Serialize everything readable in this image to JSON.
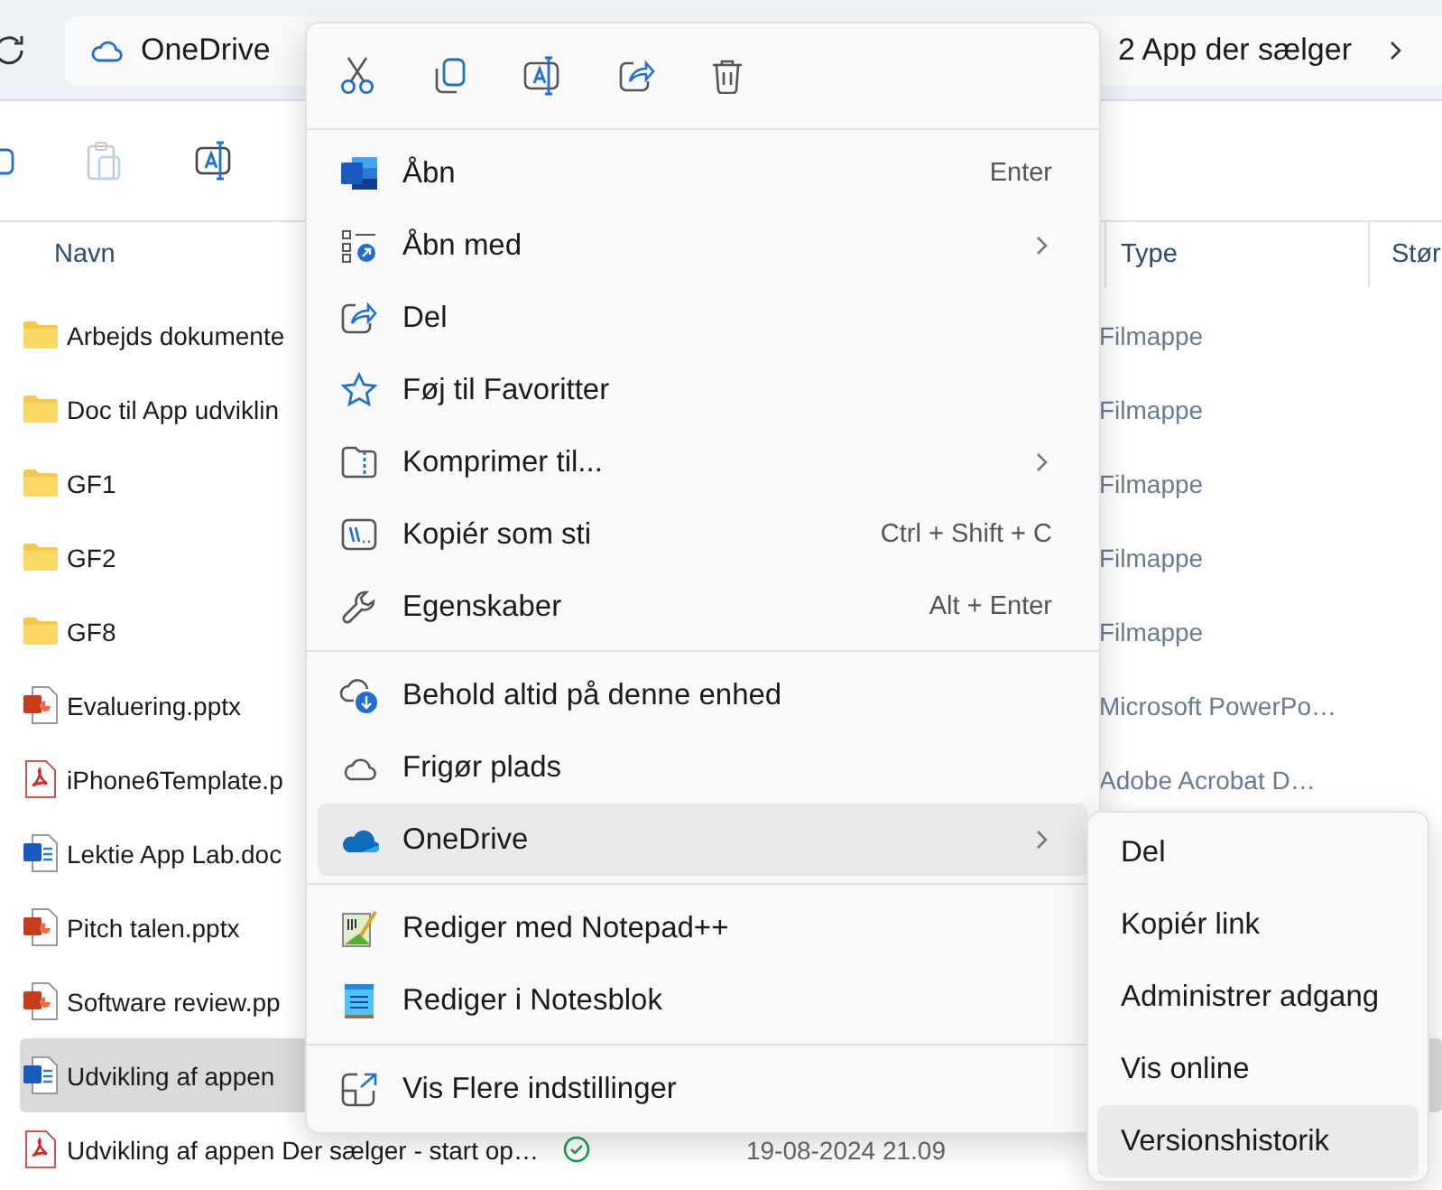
{
  "address_bar": {
    "location": "OneDrive",
    "path_tail": "2 App der sælger"
  },
  "columns": [
    {
      "label": "Navn"
    },
    {
      "label": "Type"
    },
    {
      "label": "Stør"
    }
  ],
  "files": [
    {
      "kind": "folder",
      "name": "Arbejds dokumente",
      "type": "Filmappe",
      "selected": false
    },
    {
      "kind": "folder",
      "name": "Doc til App udviklin",
      "type": "Filmappe",
      "selected": false
    },
    {
      "kind": "folder",
      "name": "GF1",
      "type": "Filmappe",
      "selected": false
    },
    {
      "kind": "folder",
      "name": "GF2",
      "type": "Filmappe",
      "selected": false
    },
    {
      "kind": "folder",
      "name": "GF8",
      "type": "Filmappe",
      "selected": false
    },
    {
      "kind": "pptx",
      "name": "Evaluering.pptx",
      "type": "Microsoft PowerPo…",
      "selected": false
    },
    {
      "kind": "pdf",
      "name": "iPhone6Template.p",
      "type": "Adobe Acrobat D…",
      "selected": false
    },
    {
      "kind": "docx",
      "name": "Lektie App Lab.doc",
      "selected": false
    },
    {
      "kind": "pptx",
      "name": "Pitch talen.pptx",
      "selected": false
    },
    {
      "kind": "pptx",
      "name": "Software review.pp",
      "selected": false
    },
    {
      "kind": "docx",
      "name": "Udvikling af appen",
      "selected": true
    },
    {
      "kind": "pdf",
      "name": "Udvikling af appen Der sælger - start op…",
      "synced": true,
      "modified": "19-08-2024 21.09",
      "selected": false
    }
  ],
  "context_menu": {
    "groups": [
      {
        "items": [
          {
            "label": "Åbn",
            "shortcut": "Enter",
            "submenu": false,
            "selected": false
          },
          {
            "label": "Åbn med",
            "submenu": true,
            "selected": false
          },
          {
            "label": "Del",
            "submenu": false,
            "selected": false
          },
          {
            "label": "Føj til Favoritter",
            "submenu": false,
            "selected": false
          },
          {
            "label": "Komprimer til...",
            "submenu": true,
            "selected": false
          },
          {
            "label": "Kopiér som sti",
            "shortcut": "Ctrl + Shift + C",
            "submenu": false,
            "selected": false
          },
          {
            "label": "Egenskaber",
            "shortcut": "Alt + Enter",
            "submenu": false,
            "selected": false
          }
        ]
      },
      {
        "items": [
          {
            "label": "Behold altid på denne enhed",
            "submenu": false,
            "selected": false
          },
          {
            "label": "Frigør plads",
            "submenu": false,
            "selected": false
          },
          {
            "label": "OneDrive",
            "submenu": true,
            "selected": true
          }
        ]
      },
      {
        "items": [
          {
            "label": "Rediger med Notepad++",
            "submenu": false,
            "selected": false
          },
          {
            "label": "Rediger i Notesblok",
            "submenu": false,
            "selected": false
          }
        ]
      },
      {
        "items": [
          {
            "label": "Vis Flere indstillinger",
            "submenu": false,
            "selected": false
          }
        ]
      }
    ]
  },
  "submenu": {
    "items": [
      {
        "label": "Del",
        "selected": false
      },
      {
        "label": "Kopiér link",
        "selected": false
      },
      {
        "label": "Administrer adgang",
        "selected": false
      },
      {
        "label": "Vis online",
        "selected": false
      },
      {
        "label": "Versionshistorik",
        "selected": true
      }
    ]
  }
}
